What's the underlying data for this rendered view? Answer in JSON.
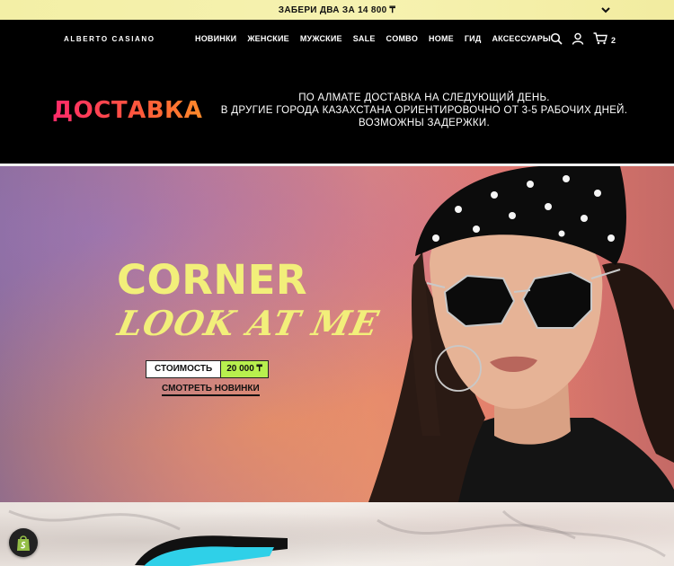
{
  "announcement": {
    "text": "ЗАБЕРИ ДВА ЗА 14 800 ₸"
  },
  "header": {
    "logo": "ALBERTO CASIANO",
    "nav": [
      "НОВИНКИ",
      "ЖЕНСКИЕ",
      "МУЖСКИЕ",
      "SALE",
      "COMBO",
      "HOME",
      "ГИД",
      "АКСЕССУАРЫ"
    ],
    "icons": [
      "search-icon",
      "account-icon",
      "cart-icon"
    ],
    "cart_count": "2"
  },
  "delivery": {
    "title": "ДОСТАВКА",
    "lines": [
      "ПО АЛМАТЕ ДОСТАВКА НА СЛЕДУЮЩИЙ ДЕНЬ.",
      "В ДРУГИЕ ГОРОДА КАЗАХСТАНА ОРИЕНТИРОВОЧНО ОТ 3-5 РАБОЧИХ ДНЕЙ.",
      "ВОЗМОЖНЫ ЗАДЕРЖКИ."
    ]
  },
  "hero": {
    "title": "CORNER",
    "subtitle": "LOOK AT ME",
    "price_label": "СТОИМОСТЬ",
    "price_value": "20 000 ₸",
    "cta": "СМОТРЕТЬ НОВИНКИ"
  },
  "colors": {
    "announce_bg": "#f3efa6",
    "accent_yellow": "#f2ef7a",
    "price_green": "#b8f04e",
    "delivery_gradient": [
      "#ff2a6a",
      "#ff8a2a"
    ]
  }
}
